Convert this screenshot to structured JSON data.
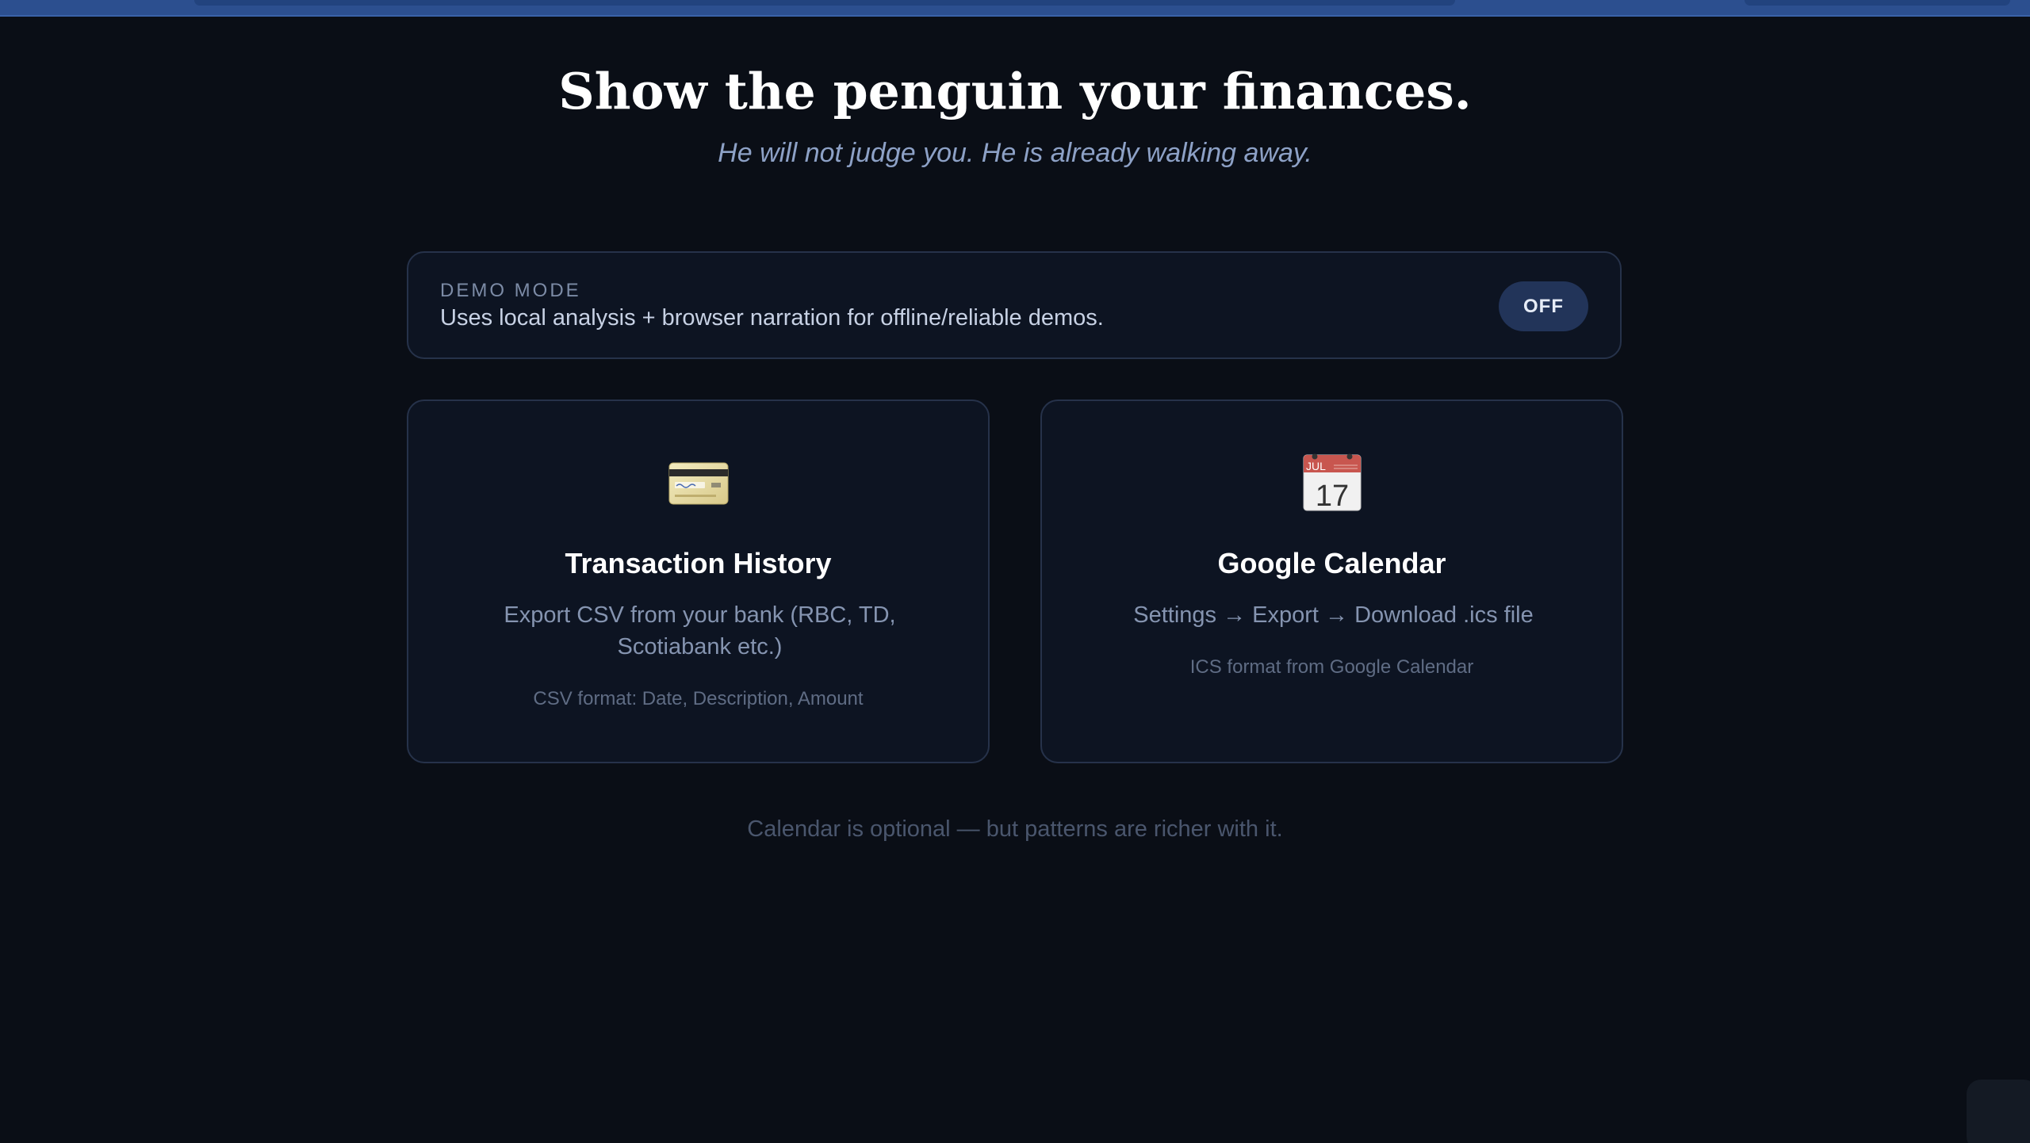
{
  "hero": {
    "title": "Show the penguin your finances.",
    "subtitle": "He will not judge you. He is already walking away."
  },
  "demo_mode": {
    "label": "DEMO MODE",
    "description": "Uses local analysis + browser narration for offline/reliable demos.",
    "toggle_label": "OFF"
  },
  "cards": [
    {
      "icon": "credit-card-icon",
      "title": "Transaction History",
      "description": "Export CSV from your bank (RBC, TD, Scotiabank etc.)",
      "note": "CSV format: Date, Description, Amount"
    },
    {
      "icon": "calendar-icon",
      "icon_month": "JUL",
      "icon_day": "17",
      "title": "Google Calendar",
      "description": "Settings → Export → Download .ics file",
      "note": "ICS format from Google Calendar"
    }
  ],
  "footer_note": "Calendar is optional — but patterns are richer with it.",
  "colors": {
    "background": "#0a0e16",
    "topbar": "#2c4f8f",
    "card_border": "#26324a",
    "toggle_bg": "#223459"
  }
}
